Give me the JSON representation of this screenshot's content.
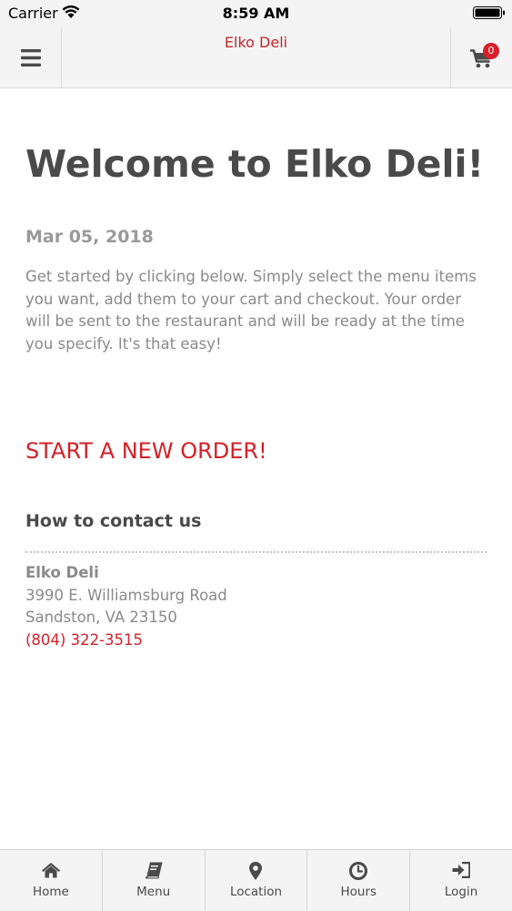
{
  "status_bar": {
    "carrier": "Carrier",
    "time": "8:59 AM"
  },
  "header": {
    "title": "Elko Deli",
    "cart_count": "0",
    "accent_color": "#c8242a"
  },
  "main": {
    "welcome_title": "Welcome to Elko Deli!",
    "date": "Mar 05, 2018",
    "intro_text": "Get started by clicking below. Simply select the menu items you want, add them to your cart and checkout. Your order will be sent to the restaurant and will be ready at the time you specify. It's that easy!",
    "start_order_label": "START A NEW ORDER!"
  },
  "contact": {
    "heading": "How to contact us",
    "name": "Elko Deli",
    "address_line1": "3990 E. Williamsburg Road",
    "address_line2": "Sandston, VA 23150",
    "phone": "(804) 322-3515"
  },
  "tabs": [
    {
      "label": "Home",
      "icon": "home-icon"
    },
    {
      "label": "Menu",
      "icon": "book-icon"
    },
    {
      "label": "Location",
      "icon": "map-pin-icon"
    },
    {
      "label": "Hours",
      "icon": "clock-icon"
    },
    {
      "label": "Login",
      "icon": "sign-in-icon"
    }
  ]
}
